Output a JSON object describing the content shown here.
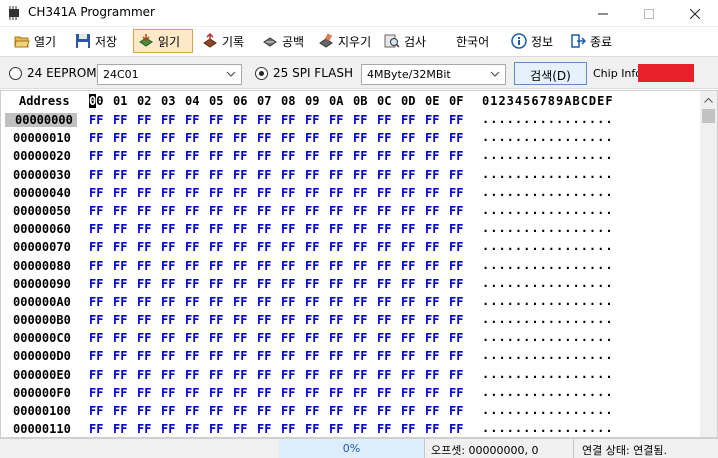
{
  "window": {
    "title": "CH341A Programmer"
  },
  "toolbar": {
    "open": "열기",
    "save": "저장",
    "read": "읽기",
    "write": "기록",
    "blank": "공백",
    "erase": "지우기",
    "verify": "검사",
    "language": "한국어",
    "about": "정보",
    "exit": "종료"
  },
  "options": {
    "eeprom_label": "24 EEPROM",
    "eeprom_select": "24C01",
    "spi_label": "25 SPI FLASH",
    "spi_select": "4MByte/32MBit",
    "detect_button": "검색(D)",
    "chip_info_label": "Chip Info:",
    "chip_info_color": "#e8202a"
  },
  "hex": {
    "address_header": "Address",
    "columns": [
      "00",
      "01",
      "02",
      "03",
      "04",
      "05",
      "06",
      "07",
      "08",
      "09",
      "0A",
      "0B",
      "0C",
      "0D",
      "0E",
      "0F"
    ],
    "ascii_header": "0123456789ABCDEF",
    "byte_value": "FF",
    "ascii_row": "................",
    "addresses": [
      "00000000",
      "00000010",
      "00000020",
      "00000030",
      "00000040",
      "00000050",
      "00000060",
      "00000070",
      "00000080",
      "00000090",
      "000000A0",
      "000000B0",
      "000000C0",
      "000000D0",
      "000000E0",
      "000000F0",
      "00000100",
      "00000110"
    ]
  },
  "status": {
    "progress": "0%",
    "progress_value": 0,
    "offset": "오프셋: 00000000, 0",
    "connection": "연결 상태: 연결됨."
  }
}
